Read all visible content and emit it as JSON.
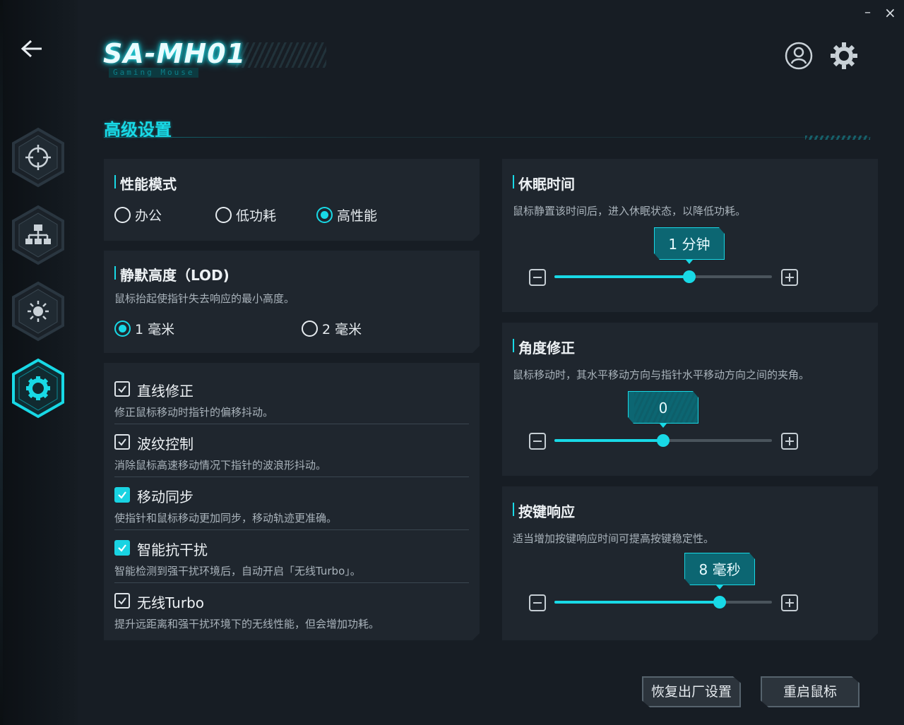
{
  "window": {
    "minimize_label": "–",
    "close_label": "×"
  },
  "brand": {
    "title": "SA-MH01",
    "subtitle": "Gaming Mouse"
  },
  "sidebar": {
    "items": [
      {
        "icon": "crosshair-icon"
      },
      {
        "icon": "network-icon"
      },
      {
        "icon": "brightness-icon"
      },
      {
        "icon": "gear-icon",
        "active": true
      }
    ]
  },
  "section": {
    "title": "高级设置"
  },
  "performance": {
    "title": "性能模式",
    "options": [
      {
        "label": "办公",
        "selected": false
      },
      {
        "label": "低功耗",
        "selected": false
      },
      {
        "label": "高性能",
        "selected": true
      }
    ]
  },
  "lod": {
    "title": "静默高度（LOD)",
    "description": "鼠标抬起使指针失去响应的最小高度。",
    "options": [
      {
        "label": "1 毫米",
        "selected": true
      },
      {
        "label": "2 毫米",
        "selected": false
      }
    ]
  },
  "toggles": [
    {
      "label": "直线修正",
      "description": "修正鼠标移动时指针的偏移抖动。",
      "checked": true,
      "style": "outline"
    },
    {
      "label": "波纹控制",
      "description": "消除鼠标高速移动情况下指针的波浪形抖动。",
      "checked": true,
      "style": "outline"
    },
    {
      "label": "移动同步",
      "description": "使指针和鼠标移动更加同步，移动轨迹更准确。",
      "checked": true,
      "style": "filled"
    },
    {
      "label": "智能抗干扰",
      "description": "智能检测到强干扰环境后，自动开启「无线Turbo」。",
      "checked": true,
      "style": "filled"
    },
    {
      "label": "无线Turbo",
      "description": "提升远距离和强干扰环境下的无线性能，但会增加功耗。",
      "checked": true,
      "style": "outline"
    }
  ],
  "sleep": {
    "title": "休眠时间",
    "description": "鼠标静置该时间后，进入休眠状态，以降低功耗。",
    "value_label": "1 分钟",
    "level": 0.62
  },
  "angle": {
    "title": "角度修正",
    "description": "鼠标移动时，其水平移动方向与指针水平移动方向之间的夹角。",
    "value_label": "0",
    "level": 0.5
  },
  "key_response": {
    "title": "按键响应",
    "description": "适当增加按键响应时间可提高按键稳定性。",
    "value_label": "8 毫秒",
    "level": 0.76
  },
  "footer": {
    "reset_label": "恢复出厂设置",
    "restart_label": "重启鼠标"
  },
  "colors": {
    "accent": "#18d9e6",
    "background": "#171d24",
    "card": "#1f262e"
  }
}
